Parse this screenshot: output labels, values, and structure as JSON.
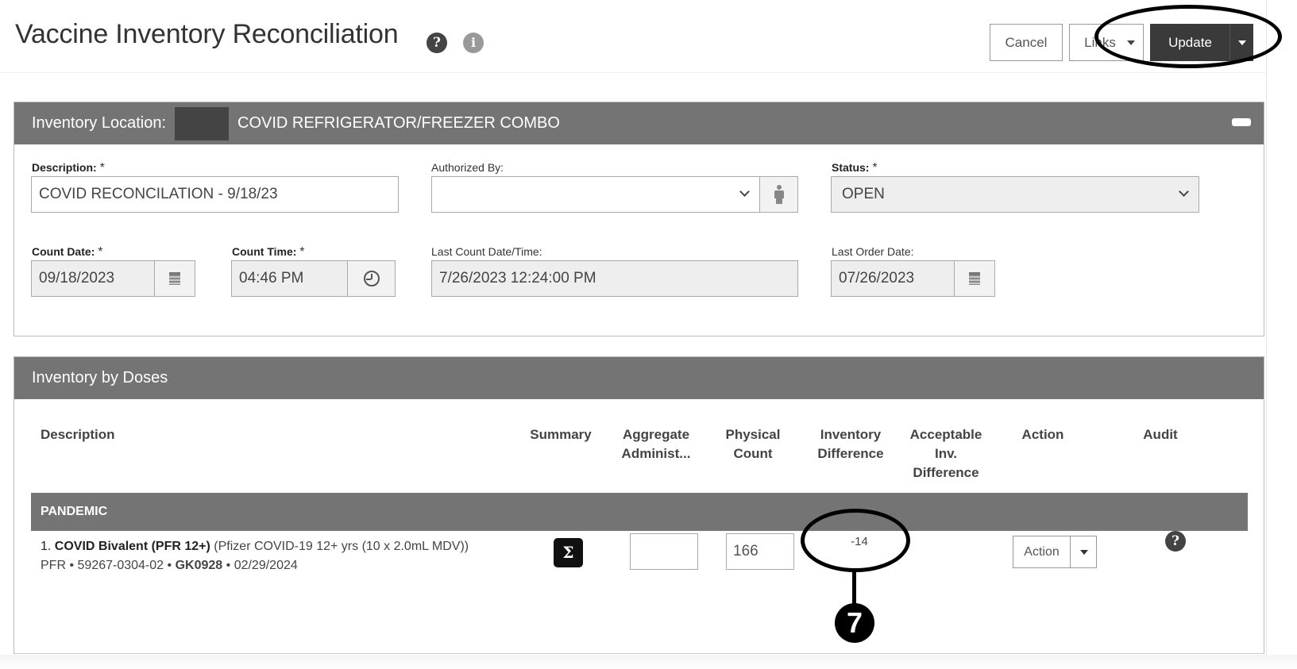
{
  "header": {
    "title": "Vaccine Inventory Reconciliation",
    "help_icon": "question-circle-icon",
    "info_icon": "info-circle-icon",
    "buttons": {
      "cancel": "Cancel",
      "links": "Links",
      "update": "Update"
    }
  },
  "location_panel": {
    "label": "Inventory Location:",
    "location_name": "COVID REFRIGERATOR/FREEZER COMBO",
    "collapse_icon": "minus-icon",
    "fields": {
      "description": {
        "label": "Description:",
        "required": "*",
        "value": "COVID RECONCILATION - 9/18/23"
      },
      "authorized_by": {
        "label": "Authorized By:",
        "value": ""
      },
      "status": {
        "label": "Status:",
        "required": "*",
        "value": "OPEN"
      },
      "count_date": {
        "label": "Count Date:",
        "required": "*",
        "value": "09/18/2023"
      },
      "count_time": {
        "label": "Count Time:",
        "required": "*",
        "value": "04:46 PM"
      },
      "last_count": {
        "label": "Last Count Date/Time:",
        "value": "7/26/2023 12:24:00 PM"
      },
      "last_order": {
        "label": "Last Order Date:",
        "value": "07/26/2023"
      }
    }
  },
  "doses_panel": {
    "title": "Inventory by Doses",
    "columns": [
      {
        "line1": "Description",
        "line2": "",
        "line3": ""
      },
      {
        "line1": "Summary",
        "line2": "",
        "line3": ""
      },
      {
        "line1": "Aggregate",
        "line2": "Administ...",
        "line3": ""
      },
      {
        "line1": "Physical",
        "line2": "Count",
        "line3": ""
      },
      {
        "line1": "Inventory",
        "line2": "Difference",
        "line3": ""
      },
      {
        "line1": "Acceptable",
        "line2": "Inv.",
        "line3": "Difference"
      },
      {
        "line1": "Action",
        "line2": "",
        "line3": ""
      },
      {
        "line1": "Audit",
        "line2": "",
        "line3": ""
      }
    ],
    "group": "PANDEMIC",
    "rows": [
      {
        "index": "1.",
        "name": "COVID Bivalent (PFR 12+)",
        "detail": "(Pfizer COVID-19 12+ yrs (10 x 2.0mL MDV))",
        "manufacturer": "PFR",
        "ndc": "59267-0304-02",
        "lot": "GK0928",
        "expiration": "02/29/2024",
        "separator": "•",
        "summary_icon": "Σ",
        "aggregate_administered": "",
        "physical_count": "166",
        "inventory_difference": "-14",
        "acceptable_difference": "",
        "action_label": "Action"
      }
    ]
  },
  "annotations": {
    "callout_number": "7"
  }
}
